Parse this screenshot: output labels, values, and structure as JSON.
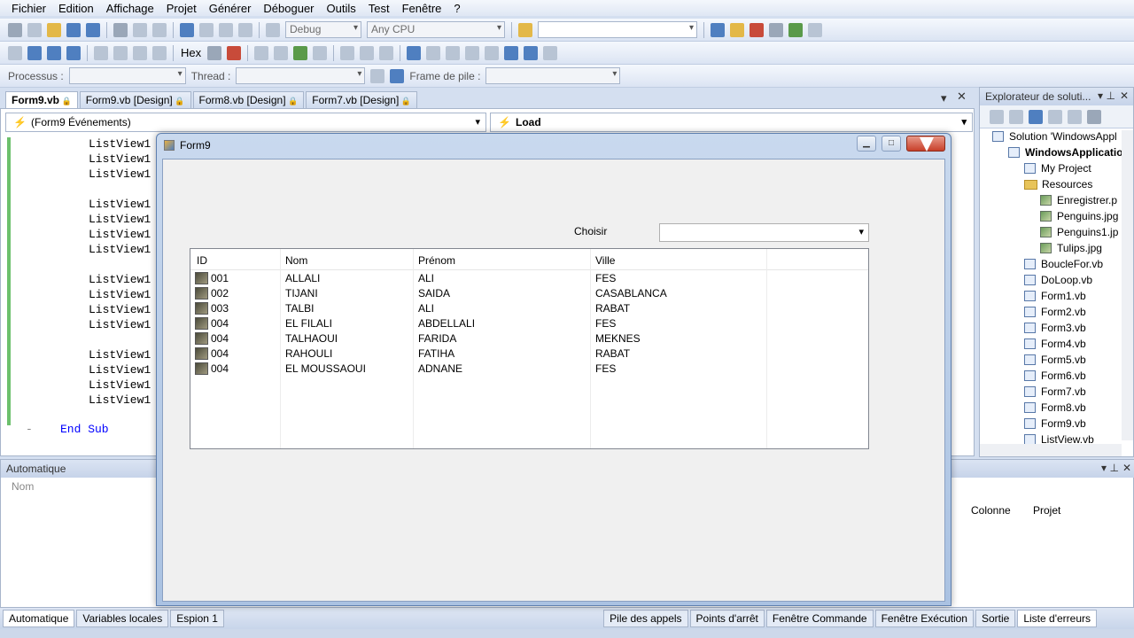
{
  "menu": [
    "Fichier",
    "Edition",
    "Affichage",
    "Projet",
    "Générer",
    "Déboguer",
    "Outils",
    "Test",
    "Fenêtre",
    "?"
  ],
  "toolbar1": {
    "config": "Debug",
    "platform": "Any CPU",
    "search_value": ""
  },
  "toolbar2": {
    "hex_label": "Hex"
  },
  "toolbar3": {
    "process_label": "Processus :",
    "thread_label": "Thread :",
    "frame_label": "Frame de pile :"
  },
  "doc_tabs": [
    "Form9.vb",
    "Form9.vb [Design]",
    "Form8.vb [Design]",
    "Form7.vb [Design]"
  ],
  "editor": {
    "left_combo": "(Form9 Événements)",
    "right_combo": "Load",
    "code_lines": [
      "ListView1",
      "ListView1",
      "ListView1",
      "",
      "ListView1",
      "ListView1",
      "ListView1",
      "ListView1",
      "",
      "ListView1",
      "ListView1",
      "ListView1",
      "ListView1",
      "",
      "ListView1",
      "ListView1",
      "ListView1",
      "ListView1"
    ],
    "end_sub": "End Sub"
  },
  "solution": {
    "title": "Explorateur de soluti...",
    "items": [
      {
        "label": "Solution 'WindowsAppl",
        "icon": "solution-icon",
        "indent": 0,
        "bold": false
      },
      {
        "label": "WindowsApplicatio",
        "icon": "project-icon",
        "indent": 1,
        "bold": true
      },
      {
        "label": "My Project",
        "icon": "file-icon",
        "indent": 2,
        "bold": false
      },
      {
        "label": "Resources",
        "icon": "folder-icon",
        "indent": 2,
        "bold": false
      },
      {
        "label": "Enregistrer.p",
        "icon": "image-icon",
        "indent": 3,
        "bold": false
      },
      {
        "label": "Penguins.jpg",
        "icon": "image-icon",
        "indent": 3,
        "bold": false
      },
      {
        "label": "Penguins1.jp",
        "icon": "image-icon",
        "indent": 3,
        "bold": false
      },
      {
        "label": "Tulips.jpg",
        "icon": "image-icon",
        "indent": 3,
        "bold": false
      },
      {
        "label": "BoucleFor.vb",
        "icon": "file-icon",
        "indent": 2,
        "bold": false
      },
      {
        "label": "DoLoop.vb",
        "icon": "file-icon",
        "indent": 2,
        "bold": false
      },
      {
        "label": "Form1.vb",
        "icon": "file-icon",
        "indent": 2,
        "bold": false
      },
      {
        "label": "Form2.vb",
        "icon": "file-icon",
        "indent": 2,
        "bold": false
      },
      {
        "label": "Form3.vb",
        "icon": "file-icon",
        "indent": 2,
        "bold": false
      },
      {
        "label": "Form4.vb",
        "icon": "file-icon",
        "indent": 2,
        "bold": false
      },
      {
        "label": "Form5.vb",
        "icon": "file-icon",
        "indent": 2,
        "bold": false
      },
      {
        "label": "Form6.vb",
        "icon": "file-icon",
        "indent": 2,
        "bold": false
      },
      {
        "label": "Form7.vb",
        "icon": "file-icon",
        "indent": 2,
        "bold": false
      },
      {
        "label": "Form8.vb",
        "icon": "file-icon",
        "indent": 2,
        "bold": false
      },
      {
        "label": "Form9.vb",
        "icon": "file-icon",
        "indent": 2,
        "bold": false
      },
      {
        "label": "ListView.vb",
        "icon": "file-icon",
        "indent": 2,
        "bold": false
      }
    ]
  },
  "auto_panel": {
    "title": "Automatique",
    "col_name": "Nom",
    "col_colonne": "Colonne",
    "col_projet": "Projet"
  },
  "bottom_tabs_left": [
    "Automatique",
    "Variables locales",
    "Espion 1"
  ],
  "bottom_tabs_right": [
    "Pile des appels",
    "Points d'arrêt",
    "Fenêtre Commande",
    "Fenêtre Exécution",
    "Sortie",
    "Liste d'erreurs"
  ],
  "form9": {
    "title": "Form9",
    "choisir_label": "Choisir",
    "combo_value": "",
    "columns": [
      "ID",
      "Nom",
      "Prénom",
      "Ville"
    ],
    "rows": [
      [
        "001",
        "ALLALI",
        "ALI",
        "FES"
      ],
      [
        "002",
        "TIJANI",
        "SAIDA",
        "CASABLANCA"
      ],
      [
        "003",
        "TALBI",
        "ALI",
        "RABAT"
      ],
      [
        "004",
        "EL FILALI",
        "ABDELLALI",
        "FES"
      ],
      [
        "004",
        "TALHAOUI",
        "FARIDA",
        "MEKNES"
      ],
      [
        "004",
        "RAHOULI",
        "FATIHA",
        "RABAT"
      ],
      [
        "004",
        "EL MOUSSAOUI",
        "ADNANE",
        "FES"
      ]
    ]
  }
}
